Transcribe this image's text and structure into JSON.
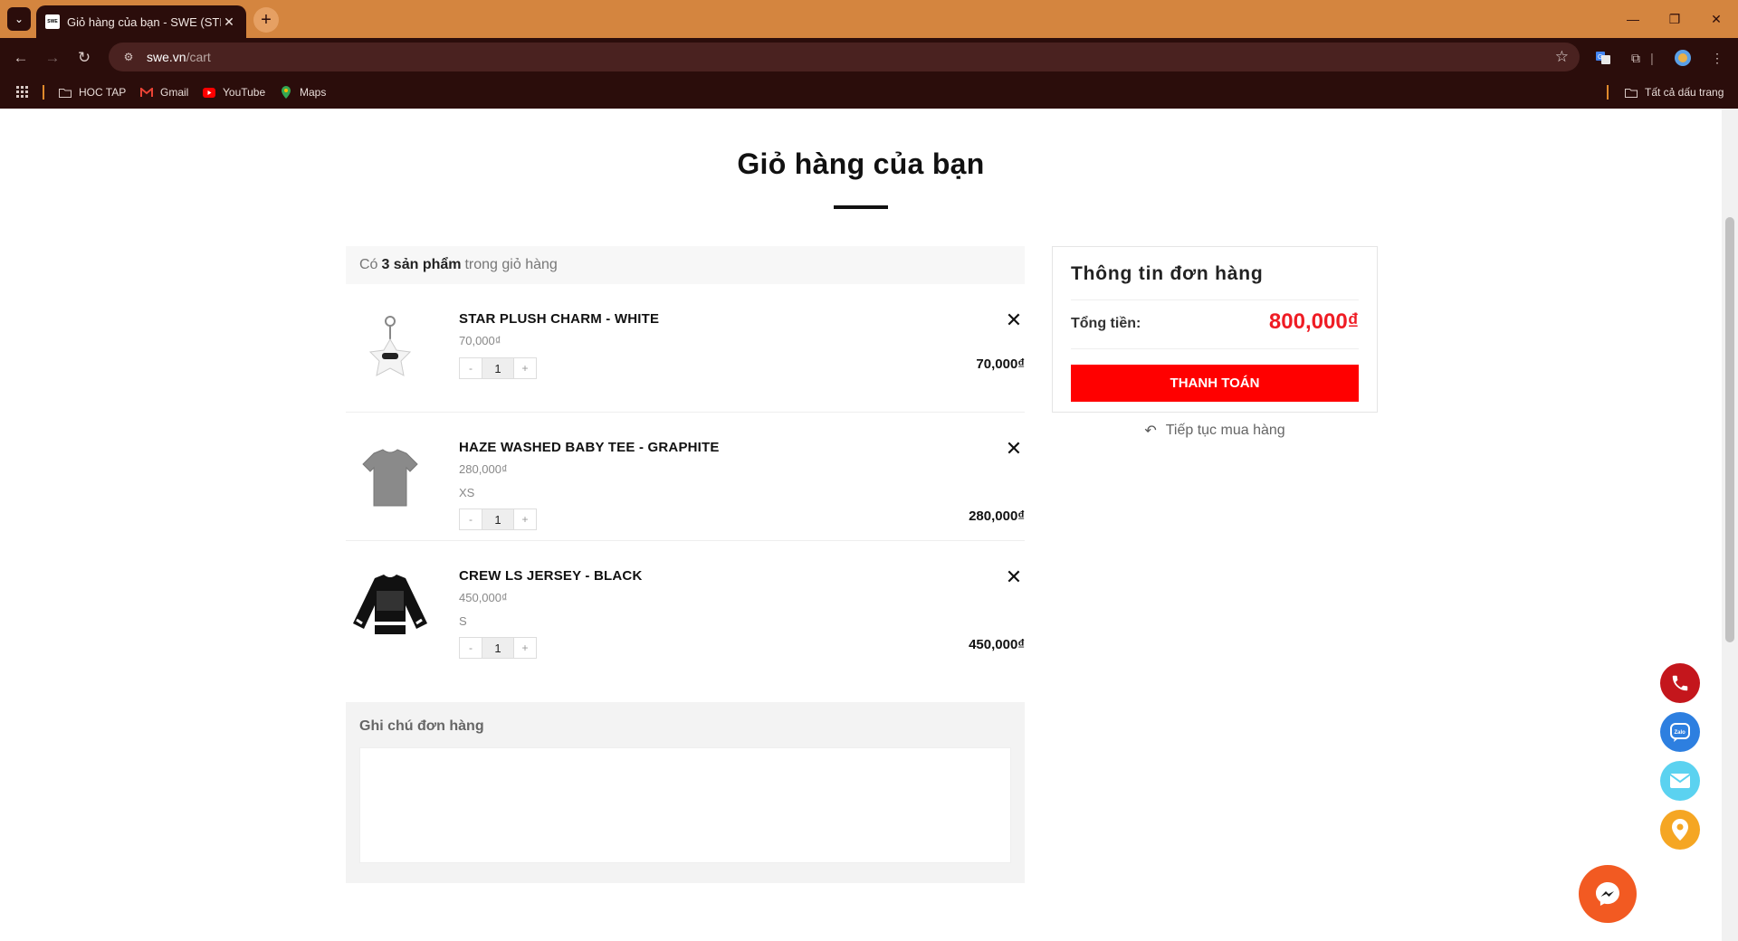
{
  "browser": {
    "tab_title": "Giỏ hàng của bạn - SWE (STREE",
    "favicon_text": "SWE",
    "url_host": "swe.vn",
    "url_path": "/cart",
    "bookmarks": [
      {
        "label": "HOC TAP",
        "icon": "folder-icon"
      },
      {
        "label": "Gmail",
        "icon": "gmail-icon"
      },
      {
        "label": "YouTube",
        "icon": "youtube-icon"
      },
      {
        "label": "Maps",
        "icon": "maps-icon"
      }
    ],
    "all_bookmarks_label": "Tất cả dấu trang"
  },
  "page": {
    "title": "Giỏ hàng của bạn",
    "count_prefix": "Có",
    "count_strong": "3 sản phẩm",
    "count_suffix": "trong giỏ hàng"
  },
  "items": [
    {
      "name": "STAR PLUSH CHARM - WHITE",
      "unit_price": "70,000₫",
      "variant": "",
      "qty": "1",
      "total": "70,000₫"
    },
    {
      "name": "HAZE WASHED BABY TEE - GRAPHITE",
      "unit_price": "280,000₫",
      "variant": "XS",
      "qty": "1",
      "total": "280,000₫"
    },
    {
      "name": "CREW LS JERSEY - BLACK",
      "unit_price": "450,000₫",
      "variant": "S",
      "qty": "1",
      "total": "450,000₫"
    }
  ],
  "qty_minus": "-",
  "qty_plus": "+",
  "note": {
    "label": "Ghi chú đơn hàng",
    "value": ""
  },
  "summary": {
    "title": "Thông tin đơn hàng",
    "total_label": "Tổng tiền:",
    "total_value": "800,000₫",
    "checkout_label": "THANH TOÁN",
    "continue_label": "Tiếp tục mua hàng"
  },
  "floating": [
    {
      "name": "phone-icon",
      "color": "#c4161c"
    },
    {
      "name": "zalo-icon",
      "color": "#2d7fe0"
    },
    {
      "name": "email-icon",
      "color": "#5bd2f0"
    },
    {
      "name": "location-pin-icon",
      "color": "#f5a623"
    }
  ],
  "colors": {
    "accent": "#ff0000",
    "price": "#ef1c24",
    "chrome_top": "#d4853f",
    "chrome_dark": "#2b0d0b"
  }
}
